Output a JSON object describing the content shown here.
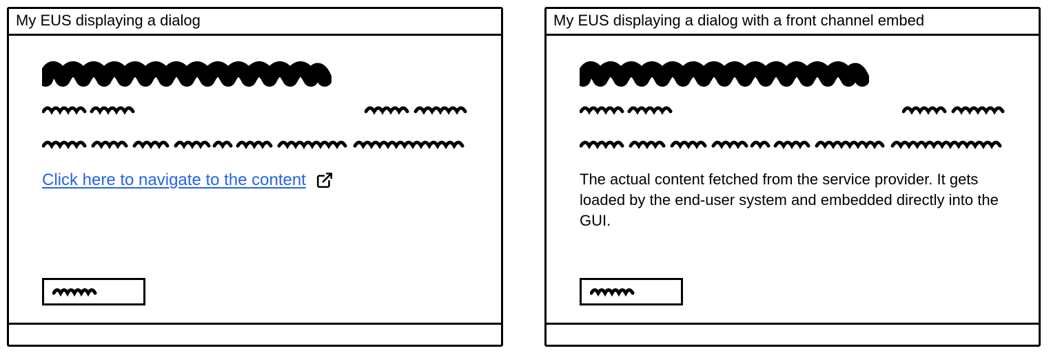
{
  "left": {
    "title": "My EUS displaying a dialog",
    "link_text": "Click here to navigate to the content",
    "link_color": "#2563eb"
  },
  "right": {
    "title": "My EUS displaying a dialog with a front channel embed",
    "embed_text": "The actual content fetched from the service provider. It gets loaded by the end-user system and embedded directly into the GUI."
  },
  "icons": {
    "external_link": "external-link-icon"
  }
}
